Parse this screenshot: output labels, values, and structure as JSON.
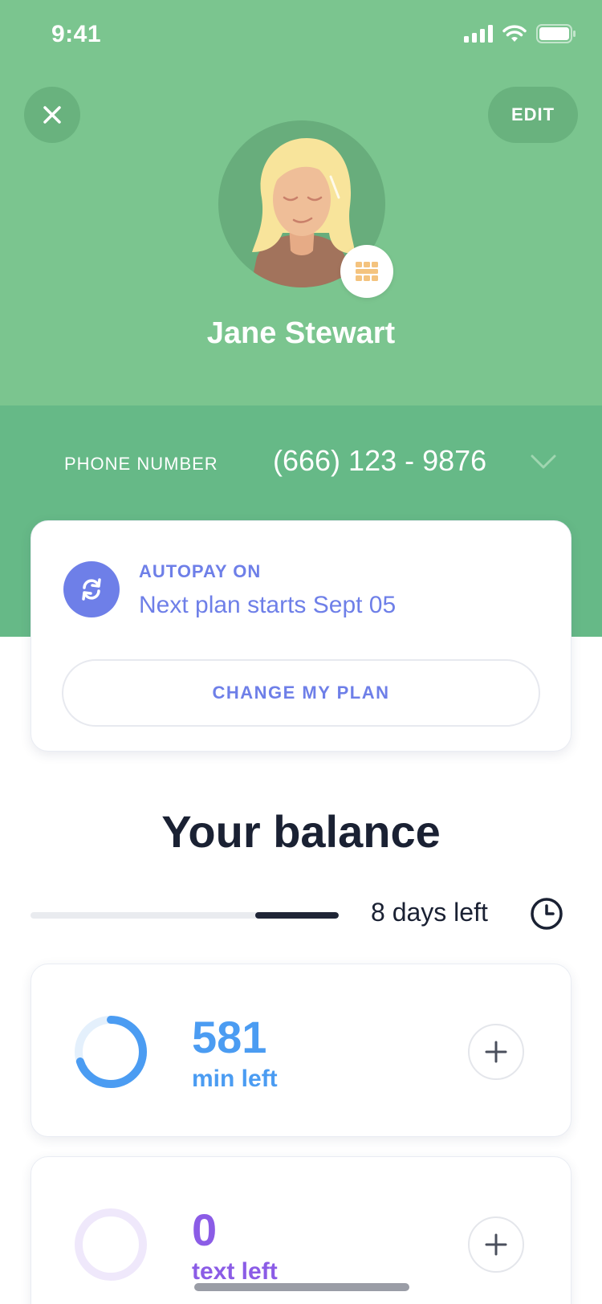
{
  "status_bar": {
    "time": "9:41"
  },
  "header": {
    "edit_label": "EDIT",
    "user_name": "Jane Stewart"
  },
  "phone": {
    "label": "PHONE NUMBER",
    "value": "(666) 123 - 9876"
  },
  "autopay": {
    "title": "AUTOPAY ON",
    "subtitle": "Next plan starts Sept 05",
    "change_plan_label": "CHANGE MY PLAN"
  },
  "balance": {
    "title": "Your balance",
    "days_left": "8 days left",
    "period_progress": 0.27
  },
  "balance_items": [
    {
      "value": "581",
      "label": "min left",
      "color": "#4b9cf2",
      "ring_track": "#e4f0fc",
      "ring_fraction": 0.7
    },
    {
      "value": "0",
      "label": "text left",
      "color": "#8b5ce6",
      "ring_track": "#efe8fb",
      "ring_fraction": 0
    }
  ],
  "colors": {
    "header_green": "#7bc58f",
    "band_green": "#66b987",
    "accent_indigo": "#6e7fe8",
    "dark_text": "#1a2133"
  },
  "icons": {
    "close": "close-icon",
    "chevron": "chevron-down-icon",
    "autopay": "refresh-icon",
    "clock": "clock-icon",
    "plus": "plus-icon",
    "badge": "sim-card-icon"
  }
}
